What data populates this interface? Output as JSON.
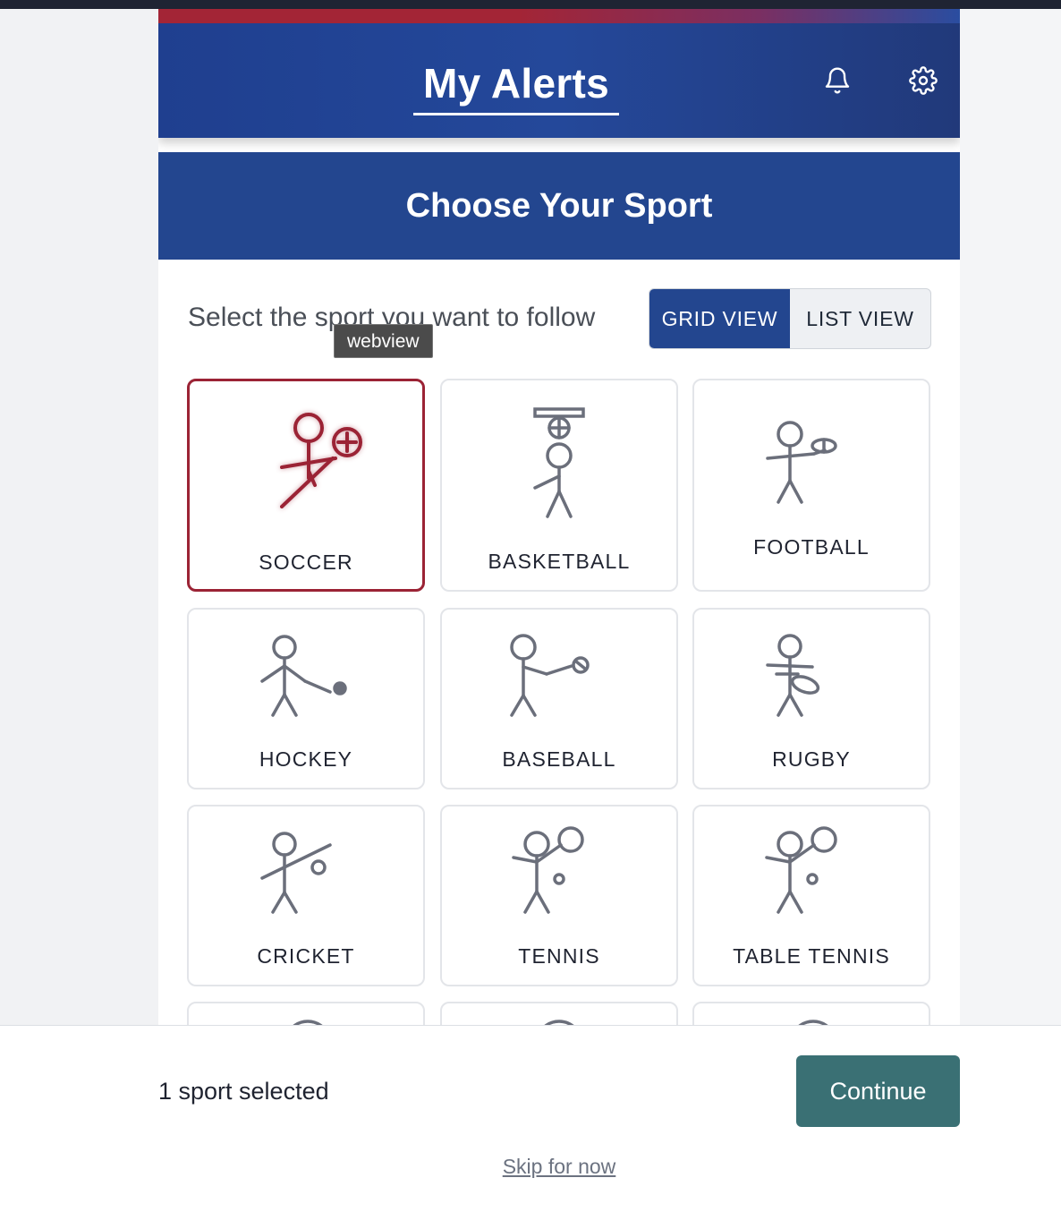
{
  "header": {
    "title": "My Alerts",
    "bell_icon": "bell-icon",
    "gear_icon": "gear-icon"
  },
  "banner": {
    "title": "Choose Your Sport"
  },
  "instruction": "Select the sport you want to follow",
  "tooltip": "webview",
  "view_toggle": {
    "grid_label": "GRID VIEW",
    "list_label": "LIST VIEW",
    "selected": "GRID VIEW"
  },
  "sports": [
    {
      "label": "SOCCER",
      "icon": "soccer-icon",
      "selected": true
    },
    {
      "label": "BASKETBALL",
      "icon": "basketball-icon",
      "selected": false
    },
    {
      "label": "FOOTBALL",
      "icon": "football-icon",
      "selected": false
    },
    {
      "label": "HOCKEY",
      "icon": "hockey-icon",
      "selected": false
    },
    {
      "label": "BASEBALL",
      "icon": "baseball-icon",
      "selected": false
    },
    {
      "label": "RUGBY",
      "icon": "rugby-icon",
      "selected": false
    },
    {
      "label": "CRICKET",
      "icon": "cricket-icon",
      "selected": false
    },
    {
      "label": "TENNIS",
      "icon": "tennis-icon",
      "selected": false
    },
    {
      "label": "TABLE TENNIS",
      "icon": "table-tennis-icon",
      "selected": false
    }
  ],
  "footer": {
    "selected_count": "1 sport selected",
    "continue_label": "Continue",
    "skip_label": "Skip for now"
  },
  "colors": {
    "header_blue": "#23468f",
    "accent_red": "#9b2335",
    "continue_teal": "#3a7074",
    "icon_gray": "#6b6f7b"
  }
}
